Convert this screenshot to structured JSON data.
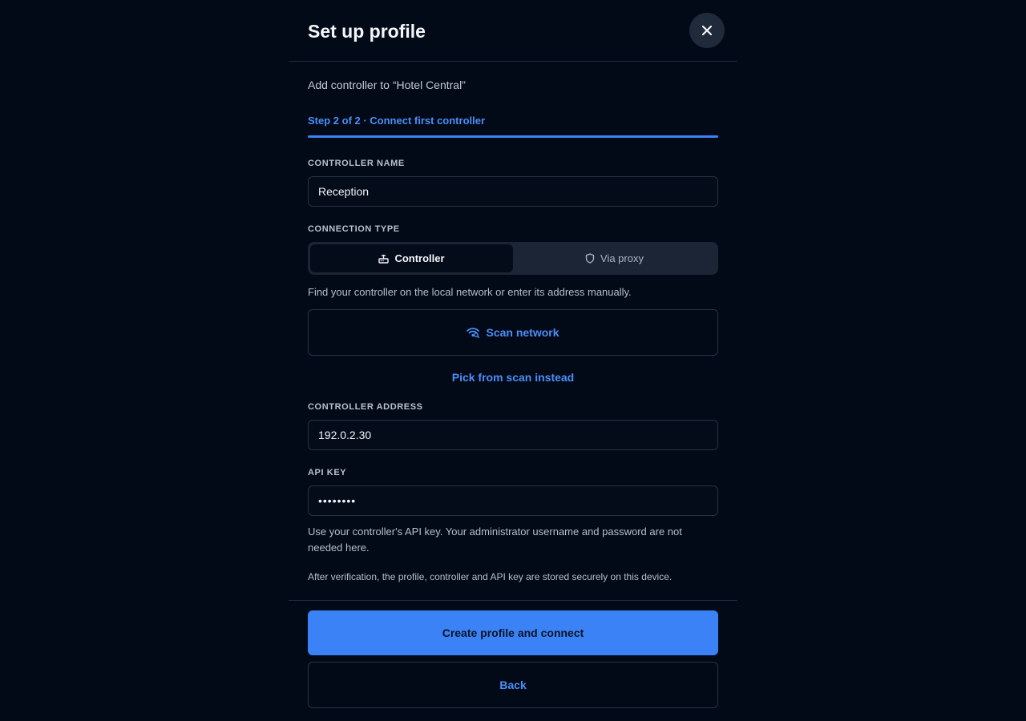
{
  "dialog": {
    "title": "Set up profile",
    "close_icon": "close-icon"
  },
  "subtitle": "Add controller to “Hotel Central”",
  "step": {
    "label": "Step 2 of 2 · Connect first controller",
    "progress": 1.0
  },
  "controller_name": {
    "label": "CONTROLLER NAME",
    "value": "Reception"
  },
  "connection_type": {
    "label": "CONNECTION TYPE",
    "options": [
      {
        "label": "Controller",
        "icon": "router-icon",
        "selected": true
      },
      {
        "label": "Via proxy",
        "icon": "shield-icon",
        "selected": false
      }
    ]
  },
  "discovery": {
    "hint": "Find your controller on the local network or enter its address manually.",
    "scan_label": "Scan network",
    "scan_icon": "wifi-scan-icon",
    "pick_label": "Pick from scan instead"
  },
  "controller_address": {
    "label": "CONTROLLER ADDRESS",
    "value": "192.0.2.30"
  },
  "api_key": {
    "label": "API KEY",
    "value": "••••••••",
    "hint": "Use your controller's API key. Your administrator username and password are not needed here."
  },
  "storage_note": "After verification, the profile, controller and API key are stored securely on this device.",
  "actions": {
    "primary_label": "Create profile and connect",
    "secondary_label": "Back"
  },
  "colors": {
    "background": "#030a17",
    "accent": "#3b82f6",
    "link": "#4b8ef7"
  }
}
